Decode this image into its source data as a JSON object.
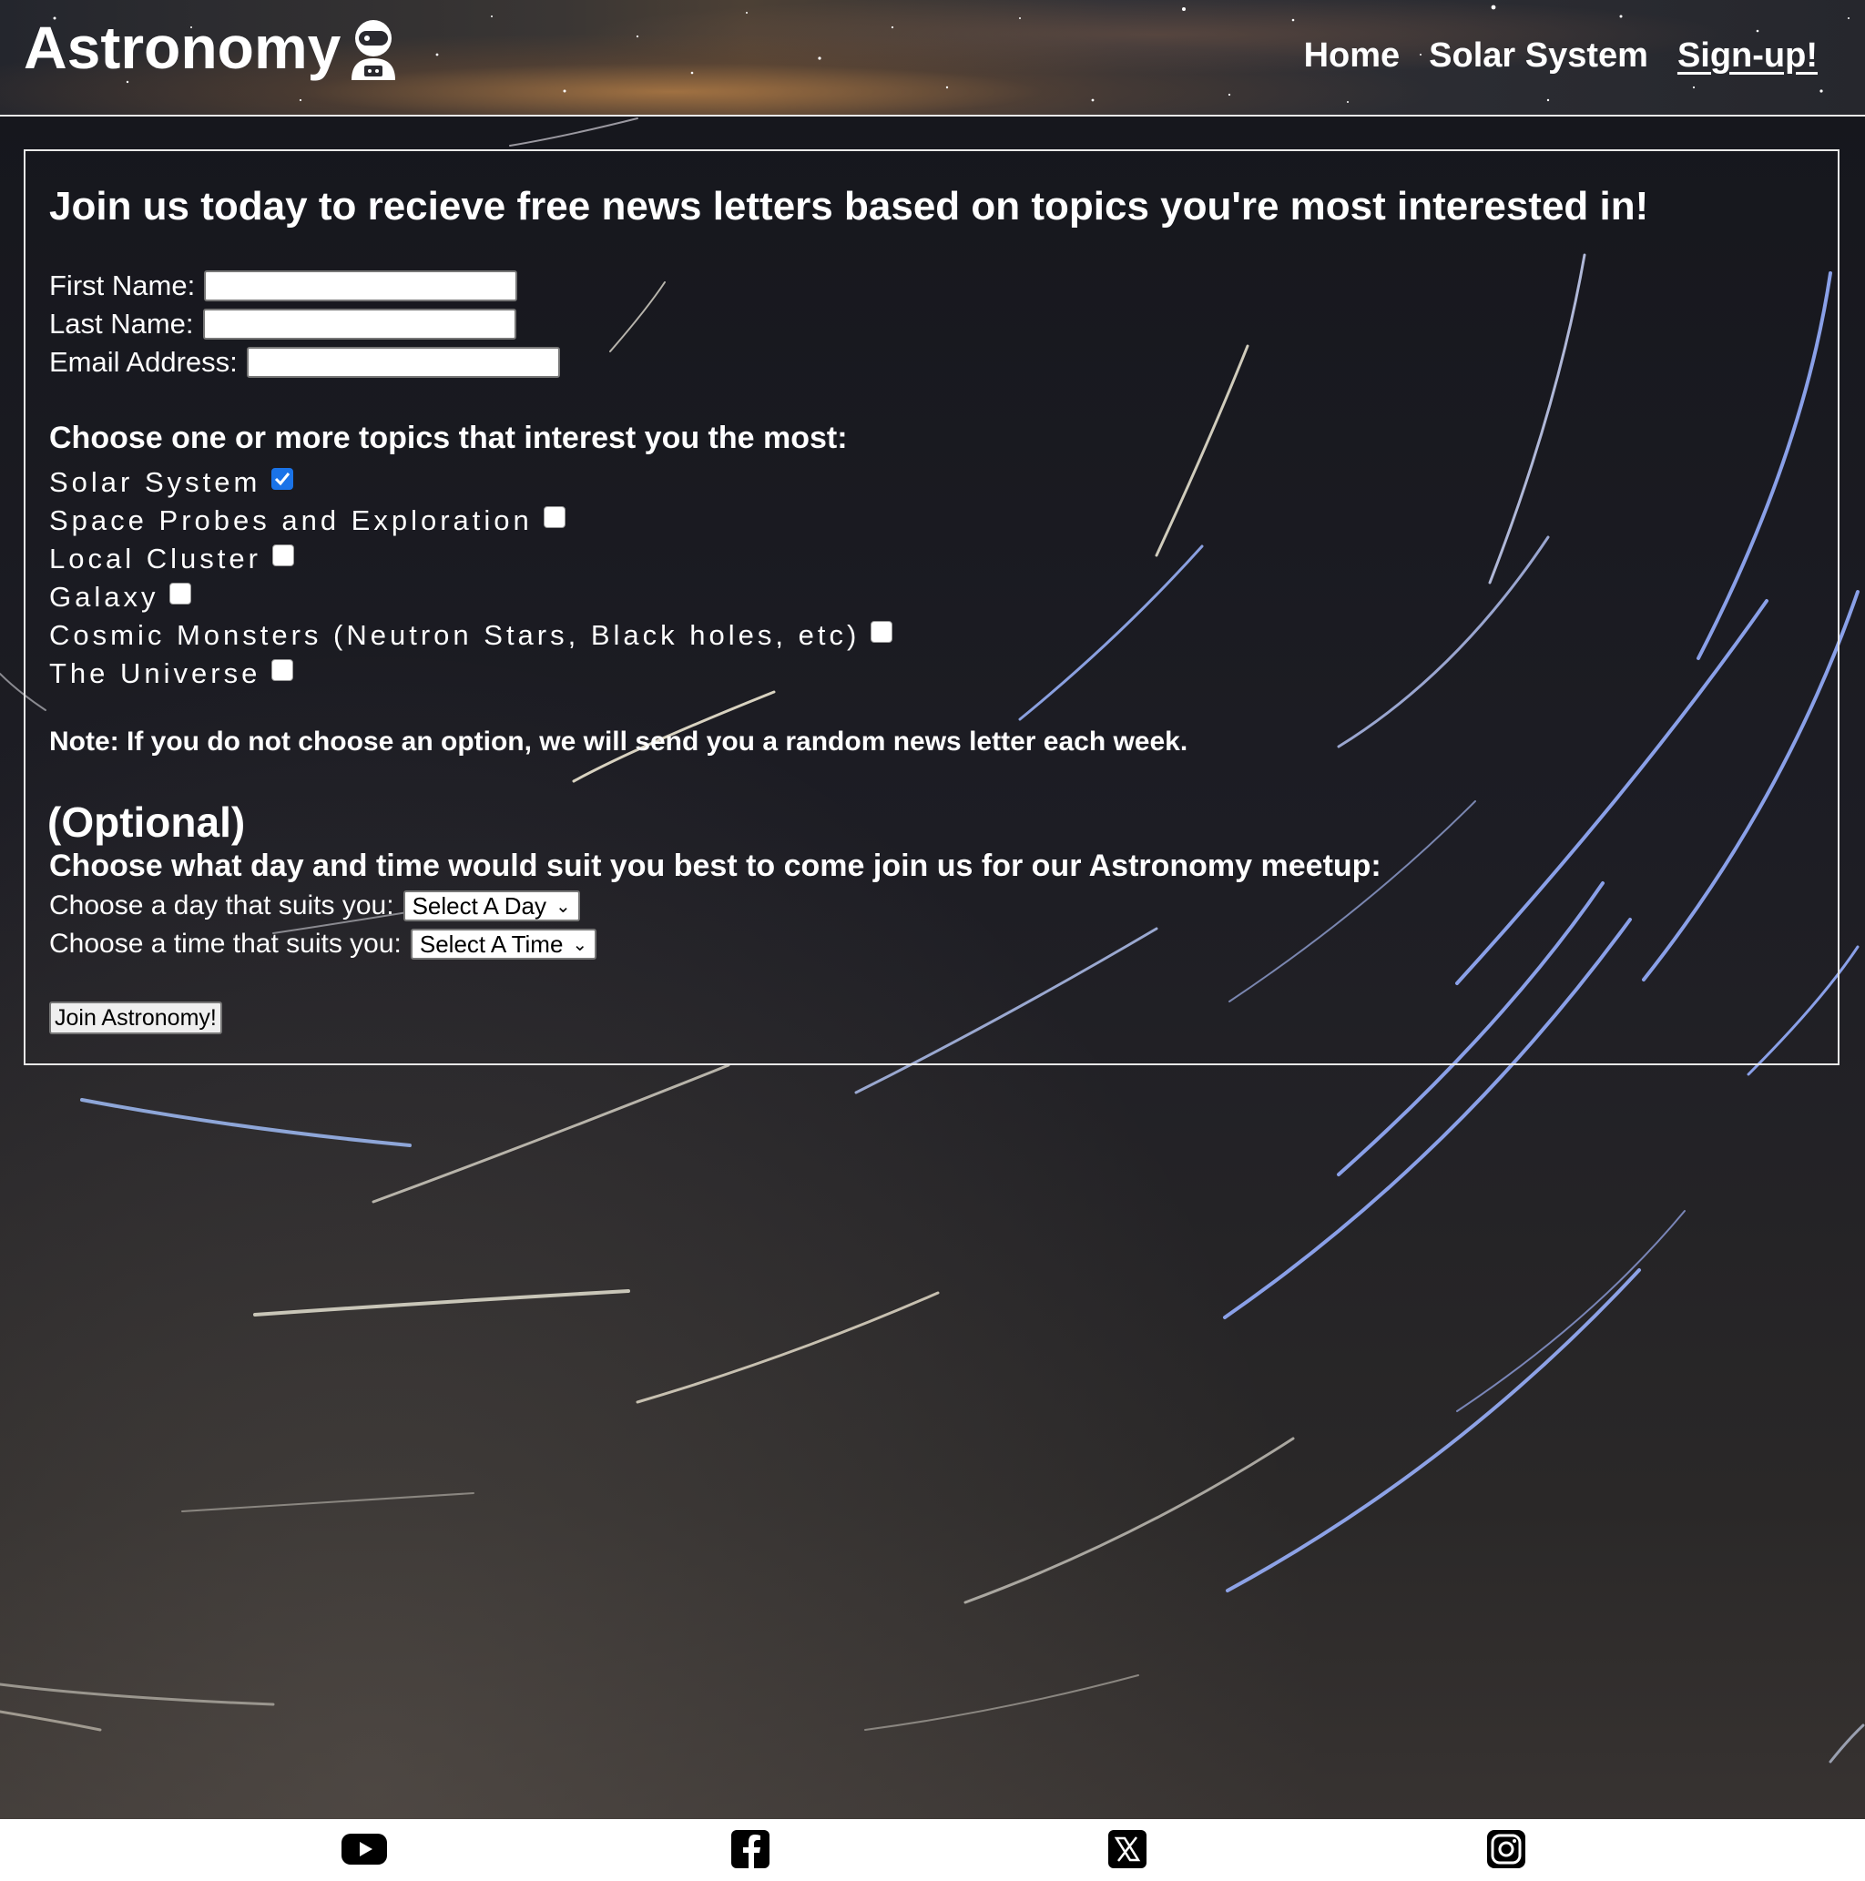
{
  "header": {
    "logo_text": "Astronomy",
    "logo_icon": "astronaut-icon",
    "nav": [
      {
        "label": "Home",
        "active": false
      },
      {
        "label": "Solar System",
        "active": false
      },
      {
        "label": "Sign-up!",
        "active": true
      }
    ]
  },
  "form": {
    "heading": "Join us today to recieve free news letters based on topics you're most interested in!",
    "fields": [
      {
        "label": "First Name:",
        "value": ""
      },
      {
        "label": "Last Name:",
        "value": ""
      },
      {
        "label": "Email Address:",
        "value": ""
      }
    ],
    "topics_heading": "Choose one or more topics that interest you the most:",
    "topics": [
      {
        "label": "Solar System",
        "checked": true
      },
      {
        "label": "Space Probes and Exploration",
        "checked": false
      },
      {
        "label": "Local Cluster",
        "checked": false
      },
      {
        "label": "Galaxy",
        "checked": false
      },
      {
        "label": "Cosmic Monsters (Neutron Stars, Black holes, etc)",
        "checked": false
      },
      {
        "label": "The Universe",
        "checked": false
      }
    ],
    "note": "Note: If you do not choose an option, we will send you a random news letter each week.",
    "optional_label": "(Optional)",
    "meetup_heading": "Choose what day and time would suit you best to come join us for our Astronomy meetup:",
    "day_label": "Choose a day that suits you:",
    "day_selected": "Select A Day",
    "time_label": "Choose a time that suits you:",
    "time_selected": "Select A Time",
    "submit_label": "Join Astronomy!"
  },
  "footer": {
    "social_icons": [
      "youtube-icon",
      "facebook-icon",
      "x-icon",
      "instagram-icon"
    ]
  },
  "colors": {
    "text": "#ffffff",
    "checkbox_checked": "#1a73e8",
    "panel_border": "#e8e8e8",
    "footer_bg": "#ffffff"
  }
}
